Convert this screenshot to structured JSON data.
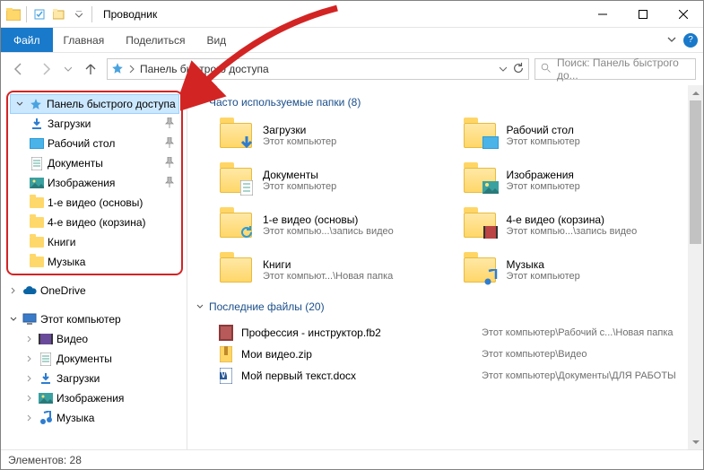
{
  "window": {
    "title": "Проводник",
    "min_tip": "Minimize",
    "max_tip": "Maximize",
    "close_tip": "Close"
  },
  "ribbon": {
    "file": "Файл",
    "tabs": [
      "Главная",
      "Поделиться",
      "Вид"
    ]
  },
  "address": {
    "text": "Панель быстрого доступа"
  },
  "search": {
    "placeholder": "Поиск: Панель быстрого до..."
  },
  "tree": {
    "quick_access": "Панель быстрого доступа",
    "quick_items": [
      {
        "label": "Загрузки",
        "icon": "download",
        "pinned": true
      },
      {
        "label": "Рабочий стол",
        "icon": "desktop",
        "pinned": true
      },
      {
        "label": "Документы",
        "icon": "document",
        "pinned": true
      },
      {
        "label": "Изображения",
        "icon": "picture",
        "pinned": true
      },
      {
        "label": "1-е видео (основы)",
        "icon": "folder",
        "pinned": false
      },
      {
        "label": "4-е видео (корзина)",
        "icon": "folder",
        "pinned": false
      },
      {
        "label": "Книги",
        "icon": "folder",
        "pinned": false
      },
      {
        "label": "Музыка",
        "icon": "folder",
        "pinned": false
      }
    ],
    "onedrive": "OneDrive",
    "this_pc": "Этот компьютер",
    "pc_items": [
      {
        "label": "Видео",
        "icon": "video"
      },
      {
        "label": "Документы",
        "icon": "document"
      },
      {
        "label": "Загрузки",
        "icon": "download"
      },
      {
        "label": "Изображения",
        "icon": "picture"
      },
      {
        "label": "Музыка",
        "icon": "music"
      }
    ]
  },
  "sections": {
    "frequent": "Часто используемые папки (8)",
    "recent": "Последние файлы (20)"
  },
  "frequent_folders": [
    {
      "name": "Загрузки",
      "path": "Этот компьютер",
      "overlay": "download"
    },
    {
      "name": "Рабочий стол",
      "path": "Этот компьютер",
      "overlay": "desktop"
    },
    {
      "name": "Документы",
      "path": "Этот компьютер",
      "overlay": "document"
    },
    {
      "name": "Изображения",
      "path": "Этот компьютер",
      "overlay": "picture"
    },
    {
      "name": "1-е видео (основы)",
      "path": "Этот компью...\\запись видео",
      "overlay": "refresh"
    },
    {
      "name": "4-е видео (корзина)",
      "path": "Этот компью...\\запись видео",
      "overlay": "video"
    },
    {
      "name": "Книги",
      "path": "Этот компьют...\\Новая папка",
      "overlay": "none"
    },
    {
      "name": "Музыка",
      "path": "Этот компьютер",
      "overlay": "music"
    }
  ],
  "recent_files": [
    {
      "name": "Профессия - инструктор.fb2",
      "path": "Этот компьютер\\Рабочий с...\\Новая папка",
      "icon": "fb2"
    },
    {
      "name": "Мои видео.zip",
      "path": "Этот компьютер\\Видео",
      "icon": "zip"
    },
    {
      "name": "Мой первый текст.docx",
      "path": "Этот компьютер\\Документы\\ДЛЯ РАБОТЫ",
      "icon": "docx"
    }
  ],
  "status": {
    "text": "Элементов: 28"
  }
}
